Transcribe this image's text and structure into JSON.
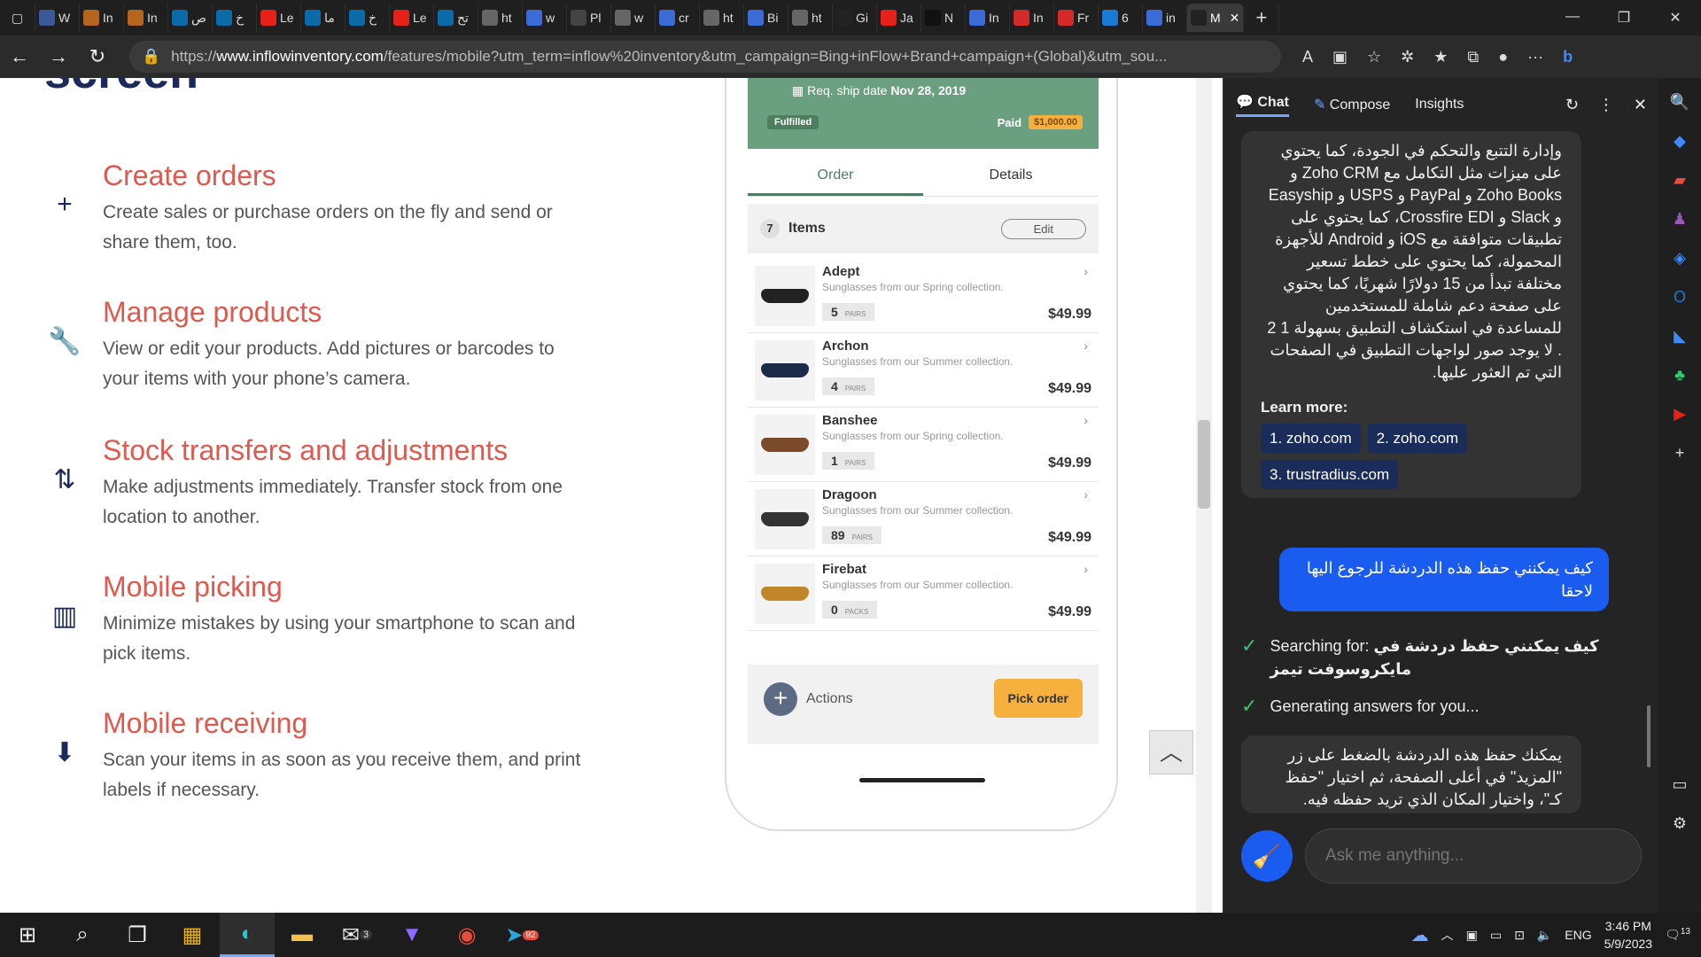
{
  "tabs": [
    {
      "label": "W",
      "color": "#3b5998"
    },
    {
      "label": "In",
      "color": "#b5651d"
    },
    {
      "label": "In",
      "color": "#b5651d"
    },
    {
      "label": "ص",
      "color": "#0b6aa8"
    },
    {
      "label": "خ",
      "color": "#0b6aa8"
    },
    {
      "label": "Le",
      "color": "#e62117"
    },
    {
      "label": "ما",
      "color": "#0b6aa8"
    },
    {
      "label": "خ",
      "color": "#0b6aa8"
    },
    {
      "label": "Le",
      "color": "#e62117"
    },
    {
      "label": "تح",
      "color": "#0b6aa8"
    },
    {
      "label": "ht",
      "color": "#666"
    },
    {
      "label": "w",
      "color": "#3b6bd6"
    },
    {
      "label": "Pl",
      "color": "#444"
    },
    {
      "label": "w",
      "color": "#666"
    },
    {
      "label": "cr",
      "color": "#3b6bd6"
    },
    {
      "label": "ht",
      "color": "#666"
    },
    {
      "label": "Bi",
      "color": "#3b6bd6"
    },
    {
      "label": "ht",
      "color": "#666"
    },
    {
      "label": "Gi",
      "color": "#222"
    },
    {
      "label": "Ja",
      "color": "#e62117"
    },
    {
      "label": "N",
      "color": "#111"
    },
    {
      "label": "In",
      "color": "#3b6bd6"
    },
    {
      "label": "In",
      "color": "#d42a2a"
    },
    {
      "label": "Fr",
      "color": "#d42a2a"
    },
    {
      "label": "6",
      "color": "#1a7bd6"
    },
    {
      "label": "in",
      "color": "#3b6bd6"
    },
    {
      "label": "M",
      "color": "#222",
      "active": true
    }
  ],
  "address": {
    "prefix": "https://",
    "host": "www.inflowinventory.com",
    "path": "/features/mobile?utm_term=inflow%20inventory&utm_campaign=Bing+inFlow+Brand+campaign+(Global)&utm_sou..."
  },
  "page": {
    "top_heading": "screen",
    "features": [
      {
        "icon": "plus-icon",
        "glyph": "+",
        "title": "Create orders",
        "desc": "Create sales or purchase orders on the fly and send or share them, too."
      },
      {
        "icon": "wrench-icon",
        "glyph": "🔧",
        "title": "Manage products",
        "desc": "View or edit your products. Add pictures or barcodes to your items with your phone’s camera."
      },
      {
        "icon": "transfer-icon",
        "glyph": "⇅",
        "title": "Stock transfers and adjustments",
        "desc": "Make adjustments immediately. Transfer stock from one location to another."
      },
      {
        "icon": "barcode-icon",
        "glyph": "▥",
        "title": "Mobile picking",
        "desc": "Minimize mistakes by using your smartphone to scan and pick items."
      },
      {
        "icon": "bag-icon",
        "glyph": "⬇",
        "title": "Mobile receiving",
        "desc": "Scan your items in as soon as you receive them, and print labels if necessary."
      }
    ]
  },
  "phone": {
    "ship_label": "Req. ship date",
    "ship_date": "Nov 28, 2019",
    "status": "Fulfilled",
    "paid_label": "Paid",
    "paid_amount": "$1,000.00",
    "tab_order": "Order",
    "tab_details": "Details",
    "items_count": "7",
    "items_label": "Items",
    "edit_label": "Edit",
    "items": [
      {
        "name": "Adept",
        "desc": "Sunglasses from our Spring collection.",
        "qty": "5",
        "unit": "PAIRS",
        "price": "$49.99",
        "lens": "#222222"
      },
      {
        "name": "Archon",
        "desc": "Sunglasses from our Summer collection.",
        "qty": "4",
        "unit": "PAIRS",
        "price": "$49.99",
        "lens": "#1c2a4a"
      },
      {
        "name": "Banshee",
        "desc": "Sunglasses from our Spring collection.",
        "qty": "1",
        "unit": "PAIRS",
        "price": "$49.99",
        "lens": "#7a4a2a"
      },
      {
        "name": "Dragoon",
        "desc": "Sunglasses from our Summer collection.",
        "qty": "89",
        "unit": "PAIRS",
        "price": "$49.99",
        "lens": "#333333"
      },
      {
        "name": "Firebat",
        "desc": "Sunglasses from our Summer collection.",
        "qty": "0",
        "unit": "PACKS",
        "price": "$49.99",
        "lens": "#c2862a"
      }
    ],
    "actions_label": "Actions",
    "pick_label": "Pick order"
  },
  "chat": {
    "tab_chat": "Chat",
    "tab_compose": "Compose",
    "tab_insights": "Insights",
    "answer1": "وإدارة التتبع والتحكم في الجودة، كما يحتوي على ميزات مثل التكامل مع Zoho CRM و Zoho Books و PayPal و USPS و Easyship و Slack و Crossfire EDI، كما يحتوي على تطبيقات متوافقة مع iOS و Android للأجهزة المحمولة، كما يحتوي على خطط تسعير مختلفة تبدأ من 15 دولارًا شهريًا، كما يحتوي على صفحة دعم شاملة للمستخدمين للمساعدة في استكشاف التطبيق بسهولة 1 2 . لا يوجد صور لواجهات التطبيق في الصفحات التي تم العثور عليها.",
    "learn_more": "Learn more:",
    "links": [
      "1. zoho.com",
      "2. zoho.com",
      "3. trustradius.com"
    ],
    "user_msg": "كيف يمكنني حفظ هذه الدردشة للرجوع اليها لاحقا",
    "searching_label": "Searching for:",
    "searching_query": "كيف يمكنني حفظ دردشة في مايكروسوفت تيمز",
    "generating": "Generating answers for you...",
    "answer2": "يمكنك حفظ هذه الدردشة بالضغط على زر \"المزيد\" في أعلى الصفحة، ثم اختيار \"حفظ كـ\"، واختيار المكان الذي تريد حفظه فيه. يمكنك",
    "input_placeholder": "Ask me anything..."
  },
  "taskbar": {
    "mail_badge": "3",
    "telegram_badge": "92",
    "lang": "ENG",
    "time": "3:46 PM",
    "date": "5/9/2023",
    "notif_count": "13"
  }
}
